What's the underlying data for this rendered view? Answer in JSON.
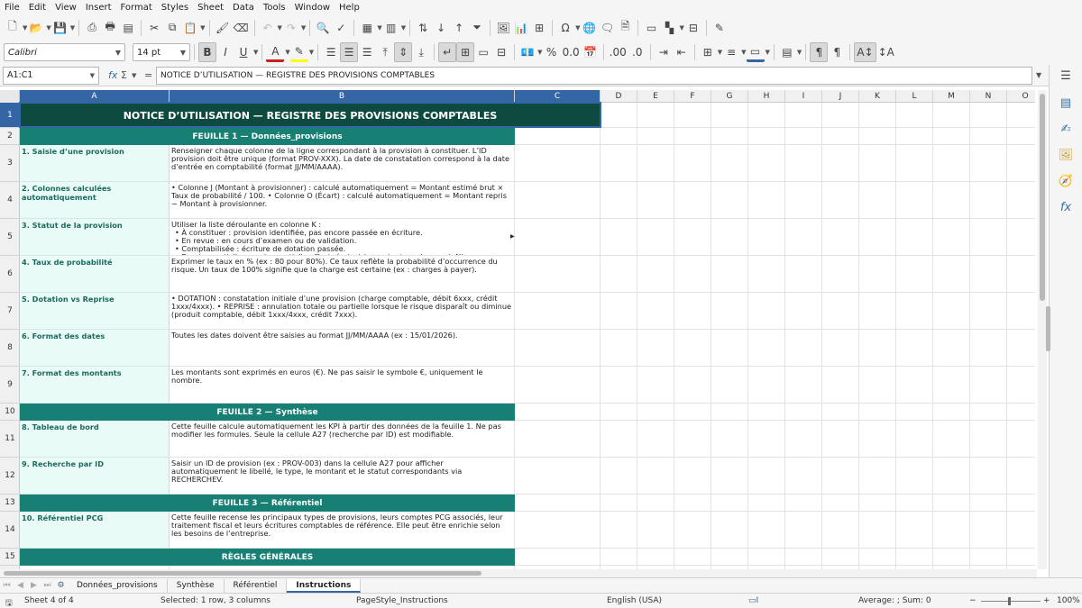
{
  "menu": [
    "File",
    "Edit",
    "View",
    "Insert",
    "Format",
    "Styles",
    "Sheet",
    "Data",
    "Tools",
    "Window",
    "Help"
  ],
  "format_toolbar": {
    "font_name": "Calibri",
    "font_size": "14 pt",
    "bold": "B",
    "italic": "I",
    "underline": "U",
    "percent": "%",
    "decimal_format": "0.0"
  },
  "formula_bar": {
    "name_box": "A1:C1",
    "function_wizard": "fx",
    "sum": "Σ",
    "equals": "=",
    "content": "NOTICE D’UTILISATION — REGISTRE DES PROVISIONS COMPTABLES"
  },
  "columns": [
    "A",
    "B",
    "C",
    "D",
    "E",
    "F",
    "G",
    "H",
    "I",
    "J",
    "K",
    "L",
    "M",
    "N",
    "O"
  ],
  "rows": [
    "1",
    "2",
    "3",
    "4",
    "5",
    "6",
    "7",
    "8",
    "9",
    "10",
    "11",
    "12",
    "13",
    "14",
    "15"
  ],
  "sheet": {
    "title": "NOTICE D’UTILISATION — REGISTRE DES PROVISIONS COMPTABLES",
    "sections": {
      "s1": "FEUILLE 1 — Données_provisions",
      "s2": "FEUILLE 2 — Synthèse",
      "s3": "FEUILLE 3 — Référentiel",
      "s4": "RÈGLES GÉNÉRALES"
    },
    "items": [
      {
        "label": "1. Saisie d’une provision",
        "text": "Renseigner chaque colonne de la ligne correspondant à la provision à constituer. L’ID provision doit être unique (format PROV-XXX). La date de constatation correspond à la date d’entrée en comptabilité (format JJ/MM/AAAA)."
      },
      {
        "label": "2. Colonnes calculées automatiquement",
        "text": "• Colonne J (Montant à provisionner) : calculé automatiquement = Montant estimé brut × Taux de probabilité / 100. • Colonne O (Écart) : calculé automatiquement = Montant repris − Montant à provisionner."
      },
      {
        "label": "3. Statut de la provision",
        "text": "Utiliser la liste déroulante en colonne K :",
        "bullets": [
          "• À constituer : provision identifiée, pas encore passée en écriture.",
          "• En revue : en cours d’examen ou de validation.",
          "• Comptabilisée : écriture de dotation passée.",
          "• Reprise partielle : reprise partielle effectuée (saisir montant repris en col. N)."
        ]
      },
      {
        "label": "4. Taux de probabilité",
        "text": "Exprimer le taux en % (ex : 80 pour 80%). Ce taux reflète la probabilité d’occurrence du risque. Un taux de 100% signifie que la charge est certaine (ex : charges à payer)."
      },
      {
        "label": "5. Dotation vs Reprise",
        "text": "• DOTATION : constatation initiale d’une provision (charge comptable, débit 6xxx, crédit 1xxx/4xxx). • REPRISE : annulation totale ou partielle lorsque le risque disparaît ou diminue (produit comptable, débit 1xxx/4xxx, crédit 7xxx)."
      },
      {
        "label": "6. Format des dates",
        "text": "Toutes les dates doivent être saisies au format JJ/MM/AAAA (ex : 15/01/2026)."
      },
      {
        "label": "7. Format des montants",
        "text": "Les montants sont exprimés en euros (€). Ne pas saisir le symbole €, uniquement le nombre."
      },
      {
        "label": "8. Tableau de bord",
        "text": "Cette feuille calcule automatiquement les KPI à partir des données de la feuille 1. Ne pas modifier les formules. Seule la cellule A27 (recherche par ID) est modifiable."
      },
      {
        "label": "9. Recherche par ID",
        "text": "Saisir un ID de provision (ex : PROV-003) dans la cellule A27 pour afficher automatiquement le libellé, le type, le montant et le statut correspondants via RECHERCHEV."
      },
      {
        "label": "10. Référentiel PCG",
        "text": "Cette feuille recense les principaux types de provisions, leurs comptes PCG associés, leur traitement fiscal et leurs écritures comptables de référence. Elle peut être enrichie selon les besoins de l’entreprise."
      }
    ]
  },
  "tabs": [
    "Données_provisions",
    "Synthèse",
    "Référentiel",
    "Instructions"
  ],
  "status": {
    "sheet": "Sheet 4 of 4",
    "selection": "Selected: 1 row, 3 columns",
    "page_style": "PageStyle_Instructions",
    "language": "English (USA)",
    "aggregate": "Average: ; Sum: 0",
    "zoom": "100%",
    "zoom_minus": "−",
    "zoom_plus": "+"
  },
  "colors": {
    "title_bg": "#0e4a40",
    "section_bg": "#177f73",
    "label_bg": "#e9fbf7",
    "label_text": "#1c6a5f",
    "selection": "#3465a4"
  }
}
